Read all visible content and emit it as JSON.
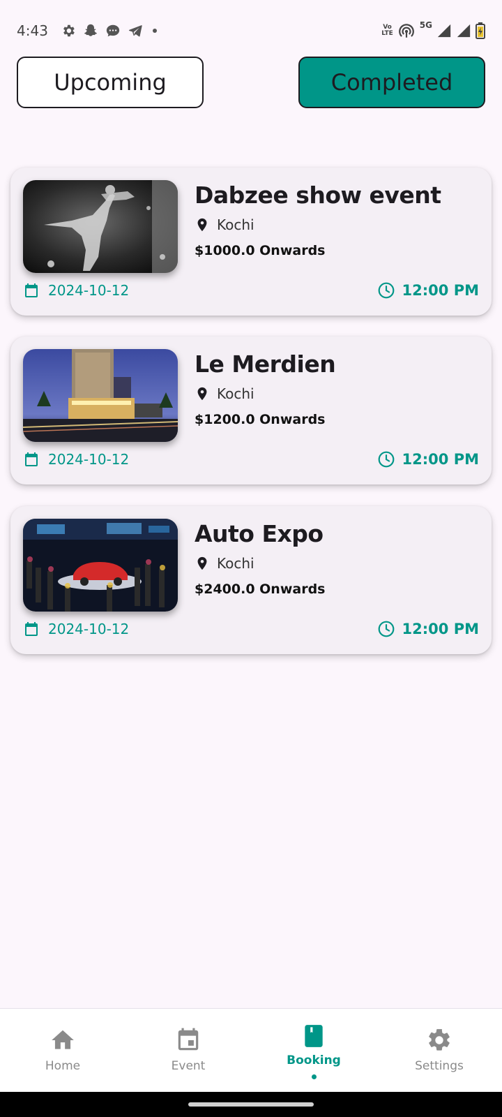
{
  "status_bar": {
    "time": "4:43",
    "volte_line1": "Vo",
    "volte_line2": "LTE",
    "network": "5G"
  },
  "tabs": {
    "upcoming_label": "Upcoming",
    "completed_label": "Completed",
    "selected": "Completed"
  },
  "bookings": [
    {
      "title": "Dabzee show event",
      "location": "Kochi",
      "price": "$1000.0 Onwards",
      "date": "2024-10-12",
      "time": "12:00 PM"
    },
    {
      "title": "Le Merdien",
      "location": "Kochi",
      "price": "$1200.0 Onwards",
      "date": "2024-10-12",
      "time": "12:00 PM"
    },
    {
      "title": "Auto Expo",
      "location": "Kochi",
      "price": "$2400.0 Onwards",
      "date": "2024-10-12",
      "time": "12:00 PM"
    }
  ],
  "bottom_nav": {
    "items": [
      {
        "label": "Home",
        "icon": "home-icon"
      },
      {
        "label": "Event",
        "icon": "calendar-event-icon"
      },
      {
        "label": "Booking",
        "icon": "bookmark-book-icon"
      },
      {
        "label": "Settings",
        "icon": "gear-icon"
      }
    ],
    "active": "Booking"
  },
  "colors": {
    "accent": "#009688",
    "background": "#fcf6fc",
    "card": "#f4eff5"
  }
}
